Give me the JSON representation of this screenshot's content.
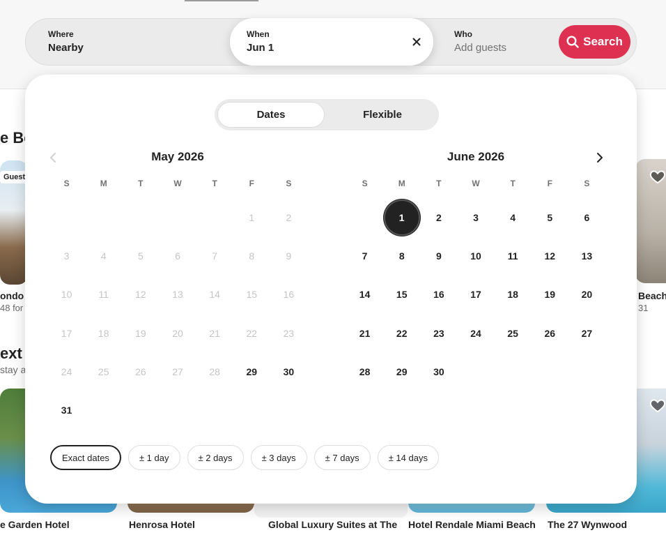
{
  "background": {
    "heading_1": "e Be",
    "heading_2": "ext",
    "sub_2": "stay a",
    "badge_guest": "Guest",
    "listing_left_name": "ondo ir",
    "listing_left_price": "48 for",
    "listing_right_name": "Beach",
    "listing_right_price": "31",
    "bottom_listings": [
      {
        "name": "e Garden Hotel"
      },
      {
        "name": "Henrosa Hotel"
      },
      {
        "name": "Global Luxury Suites at The"
      },
      {
        "name": "Hotel Rendale Miami Beach"
      },
      {
        "name": "The 27 Wynwood"
      }
    ]
  },
  "search": {
    "where_label": "Where",
    "where_value": "Nearby",
    "when_label": "When",
    "when_value": "Jun 1",
    "who_label": "Who",
    "who_placeholder": "Add guests",
    "search_label": "Search"
  },
  "toggle": {
    "dates": "Dates",
    "flexible": "Flexible"
  },
  "months": [
    {
      "title": "May 2026",
      "weekdays": [
        "S",
        "M",
        "T",
        "W",
        "T",
        "F",
        "S"
      ],
      "weeks": [
        [
          null,
          null,
          null,
          null,
          null,
          {
            "d": "1",
            "disabled": true
          },
          {
            "d": "2",
            "disabled": true
          }
        ],
        [
          {
            "d": "3",
            "disabled": true
          },
          {
            "d": "4",
            "disabled": true
          },
          {
            "d": "5",
            "disabled": true
          },
          {
            "d": "6",
            "disabled": true
          },
          {
            "d": "7",
            "disabled": true
          },
          {
            "d": "8",
            "disabled": true
          },
          {
            "d": "9",
            "disabled": true
          }
        ],
        [
          {
            "d": "10",
            "disabled": true
          },
          {
            "d": "11",
            "disabled": true
          },
          {
            "d": "12",
            "disabled": true
          },
          {
            "d": "13",
            "disabled": true
          },
          {
            "d": "14",
            "disabled": true
          },
          {
            "d": "15",
            "disabled": true
          },
          {
            "d": "16",
            "disabled": true
          }
        ],
        [
          {
            "d": "17",
            "disabled": true
          },
          {
            "d": "18",
            "disabled": true
          },
          {
            "d": "19",
            "disabled": true
          },
          {
            "d": "20",
            "disabled": true
          },
          {
            "d": "21",
            "disabled": true
          },
          {
            "d": "22",
            "disabled": true
          },
          {
            "d": "23",
            "disabled": true
          }
        ],
        [
          {
            "d": "24",
            "disabled": true
          },
          {
            "d": "25",
            "disabled": true
          },
          {
            "d": "26",
            "disabled": true
          },
          {
            "d": "27",
            "disabled": true
          },
          {
            "d": "28",
            "disabled": true
          },
          {
            "d": "29"
          },
          {
            "d": "30"
          }
        ],
        [
          {
            "d": "31"
          },
          null,
          null,
          null,
          null,
          null,
          null
        ]
      ]
    },
    {
      "title": "June 2026",
      "weekdays": [
        "S",
        "M",
        "T",
        "W",
        "T",
        "F",
        "S"
      ],
      "weeks": [
        [
          null,
          {
            "d": "1",
            "selected": true
          },
          {
            "d": "2"
          },
          {
            "d": "3"
          },
          {
            "d": "4"
          },
          {
            "d": "5"
          },
          {
            "d": "6"
          }
        ],
        [
          {
            "d": "7"
          },
          {
            "d": "8"
          },
          {
            "d": "9"
          },
          {
            "d": "10"
          },
          {
            "d": "11"
          },
          {
            "d": "12"
          },
          {
            "d": "13"
          }
        ],
        [
          {
            "d": "14"
          },
          {
            "d": "15"
          },
          {
            "d": "16"
          },
          {
            "d": "17"
          },
          {
            "d": "18"
          },
          {
            "d": "19"
          },
          {
            "d": "20"
          }
        ],
        [
          {
            "d": "21"
          },
          {
            "d": "22"
          },
          {
            "d": "23"
          },
          {
            "d": "24"
          },
          {
            "d": "25"
          },
          {
            "d": "26"
          },
          {
            "d": "27"
          }
        ],
        [
          {
            "d": "28"
          },
          {
            "d": "29"
          },
          {
            "d": "30"
          },
          null,
          null,
          null,
          null
        ]
      ]
    }
  ],
  "flex_chips": [
    {
      "label": "Exact dates",
      "active": true
    },
    {
      "label": "± 1 day"
    },
    {
      "label": "± 2 days"
    },
    {
      "label": "± 3 days"
    },
    {
      "label": "± 7 days"
    },
    {
      "label": "± 14 days"
    }
  ],
  "colors": {
    "brand": "#de3151",
    "selected_day": "#222222",
    "disabled_day": "#c4c4c4"
  },
  "icons": {
    "prev": "chevron-left-icon",
    "next": "chevron-right-icon",
    "clear": "close-icon",
    "search": "search-icon",
    "favorite": "heart-icon"
  }
}
